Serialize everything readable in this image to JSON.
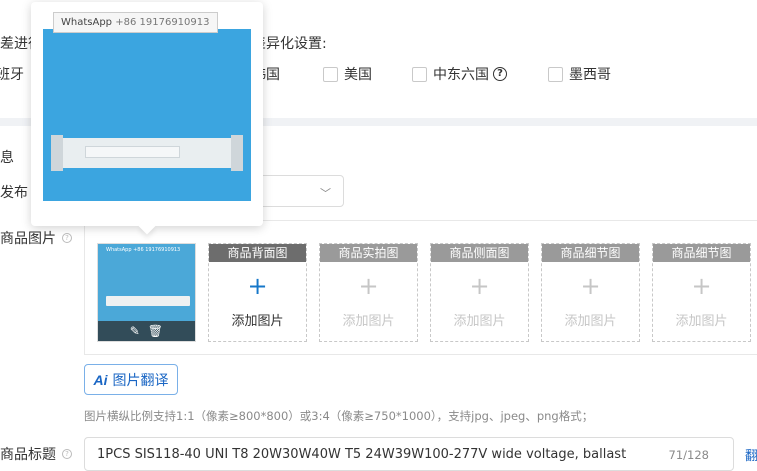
{
  "differentiation": {
    "title_left": "差进行",
    "title_right": "差异化设置:",
    "countries": [
      {
        "label": "班牙"
      },
      {
        "label": "韩国"
      },
      {
        "label": "美国"
      },
      {
        "label": "中东六国"
      },
      {
        "label": "墨西哥"
      }
    ]
  },
  "section": {
    "title": "息",
    "publish_label": "发布",
    "help_glyph": "?"
  },
  "images": {
    "label": "商品图片",
    "main_thumb_watermark": "WhatsApp +86 19176910913",
    "edit_icon_glyph": "✎",
    "delete_icon_glyph": "🗑",
    "slots": [
      {
        "header": "商品背面图",
        "plus": "+",
        "add_label": "添加图片"
      },
      {
        "header": "商品实拍图",
        "plus": "+",
        "add_label": "添加图片"
      },
      {
        "header": "商品侧面图",
        "plus": "+",
        "add_label": "添加图片"
      },
      {
        "header": "商品细节图",
        "plus": "+",
        "add_label": "添加图片"
      },
      {
        "header": "商品细节图",
        "plus": "+",
        "add_label": "添加图片"
      }
    ],
    "ai_prefix": "Ai",
    "ai_button_label": "图片翻译",
    "hint": "图片横纵比例支持1:1（像素≥800*800）或3:4（像素≥750*1000），支持jpg、jpeg、png格式；"
  },
  "product_title": {
    "label": "商品标题",
    "value": "1PCS SIS118-40 UNI T8 20W30W40W T5 24W39W100-277V wide voltage, ballast",
    "counter": "71/128",
    "edge_link": "翻"
  },
  "popover": {
    "watermark_app": "WhatsApp",
    "watermark_phone": "+86 19176910913"
  },
  "colors": {
    "accent": "#1677c9",
    "photo_blue": "#3ba5e0"
  }
}
